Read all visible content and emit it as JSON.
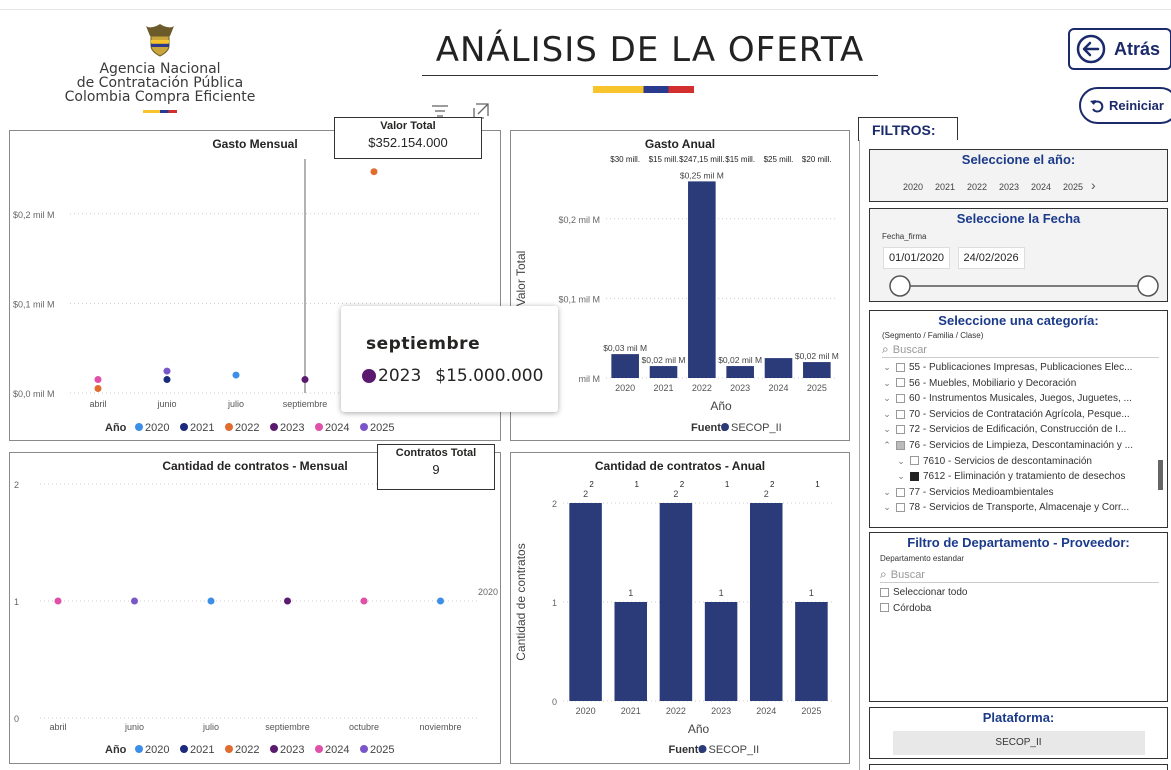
{
  "header": {
    "logo_line1": "Agencia Nacional",
    "logo_line2": "de Contratación Pública",
    "logo_line3": "Colombia Compra Eficiente",
    "title": "ANÁLISIS DE LA OFERTA",
    "back_label": "Atrás",
    "reset_label": "Reiniciar"
  },
  "colors": {
    "accent": "#1b2a6b",
    "bar": "#2b3a78",
    "year2020": "#3d8ee6",
    "year2021": "#1b2a7b",
    "year2022": "#e06c2f",
    "year2023": "#5b1a6f",
    "year2024": "#e04fa8",
    "year2025": "#7a56c8"
  },
  "cards": {
    "valor_total": {
      "label": "Valor Total",
      "value": "$352.154.000"
    },
    "contratos_total": {
      "label": "Contratos Total",
      "value": "9"
    }
  },
  "tooltip": {
    "month": "septiembre",
    "year": "2023",
    "value": "$15.000.000"
  },
  "chart_data": [
    {
      "id": "gasto_mensual",
      "type": "scatter",
      "title": "Gasto Mensual",
      "categories": [
        "abril",
        "junio",
        "julio",
        "septiembre"
      ],
      "y_ticks": [
        "$0,0 mil M",
        "$0,1 mil M",
        "$0,2 mil M"
      ],
      "ylim": [
        0,
        0.25
      ],
      "series": [
        {
          "name": "2020",
          "points": [
            {
              "x": "julio",
              "y": 0.02
            }
          ]
        },
        {
          "name": "2021",
          "points": [
            {
              "x": "junio",
              "y": 0.015
            }
          ]
        },
        {
          "name": "2022",
          "points": [
            {
              "x": "abril",
              "y": 0.005
            },
            {
              "x": "octubre",
              "y": 0.247
            }
          ]
        },
        {
          "name": "2023",
          "points": [
            {
              "x": "septiembre",
              "y": 0.015
            }
          ]
        },
        {
          "name": "2024",
          "points": [
            {
              "x": "abril",
              "y": 0.015
            }
          ]
        },
        {
          "name": "2025",
          "points": [
            {
              "x": "junio",
              "y": 0.02
            }
          ]
        }
      ],
      "legend_title": "Año",
      "legend": [
        "2020",
        "2021",
        "2022",
        "2023",
        "2024",
        "2025"
      ]
    },
    {
      "id": "gasto_anual",
      "type": "bar",
      "title": "Gasto Anual",
      "ylabel": "Valor Total",
      "xlabel": "Año",
      "categories": [
        "2020",
        "2021",
        "2022",
        "2023",
        "2024",
        "2025"
      ],
      "values": [
        0.03,
        0.015,
        0.247,
        0.015,
        0.025,
        0.02
      ],
      "data_labels": [
        "$0,03 mil M",
        "$0,02 mil M",
        "$0,25 mil M",
        "$0,02 mil M",
        "",
        "$0,02 mil M"
      ],
      "top_labels": [
        "$30 mill.",
        "$15 mill.",
        "$247,15 mill.",
        "$15 mill.",
        "$25 mill.",
        "$20 mill."
      ],
      "y_ticks": [
        "mil M",
        "$0,1 mil M",
        "$0,2 mil M"
      ],
      "ylim": [
        0,
        0.25
      ],
      "legend_title": "Fuente",
      "legend": [
        "SECOP_II"
      ]
    },
    {
      "id": "contratos_mensual",
      "type": "scatter",
      "title": "Cantidad de contratos - Mensual",
      "categories": [
        "abril",
        "junio",
        "julio",
        "septiembre",
        "octubre",
        "noviembre"
      ],
      "y_ticks": [
        "0",
        "1",
        "2"
      ],
      "ylim": [
        0,
        2
      ],
      "series": [
        {
          "name": "2020",
          "points": [
            {
              "x": "julio",
              "y": 1
            },
            {
              "x": "noviembre",
              "y": 1
            }
          ]
        },
        {
          "name": "2023",
          "points": [
            {
              "x": "septiembre",
              "y": 1
            }
          ]
        },
        {
          "name": "2024",
          "points": [
            {
              "x": "abril",
              "y": 1
            },
            {
              "x": "octubre",
              "y": 1
            }
          ]
        },
        {
          "name": "2025",
          "points": [
            {
              "x": "junio",
              "y": 1
            }
          ]
        }
      ],
      "right_label": "2020",
      "legend_title": "Año",
      "legend": [
        "2020",
        "2021",
        "2022",
        "2023",
        "2024",
        "2025"
      ]
    },
    {
      "id": "contratos_anual",
      "type": "bar",
      "title": "Cantidad de contratos - Anual",
      "ylabel": "Cantidad de contratos",
      "xlabel": "Año",
      "categories": [
        "2020",
        "2021",
        "2022",
        "2023",
        "2024",
        "2025"
      ],
      "values": [
        2,
        1,
        2,
        1,
        2,
        1
      ],
      "top_labels": [
        "2",
        "1",
        "2",
        "1",
        "2",
        "1"
      ],
      "y_ticks": [
        "0",
        "1",
        "2"
      ],
      "ylim": [
        0,
        2
      ],
      "legend_title": "Fuente",
      "legend": [
        "SECOP_II"
      ]
    }
  ],
  "filters": {
    "label": "FILTROS:",
    "year_slicer": {
      "title": "Seleccione el año:",
      "years": [
        "2020",
        "2021",
        "2022",
        "2023",
        "2024",
        "2025"
      ],
      "next_icon": "chevron-right-icon"
    },
    "date_slicer": {
      "title": "Seleccione la Fecha",
      "field": "Fecha_firma",
      "start": "01/01/2020",
      "end": "24/02/2026"
    },
    "category_slicer": {
      "title": "Seleccione una categoría:",
      "subtitle": "(Segmento / Familia / Clase)",
      "search_placeholder": "Buscar",
      "items": [
        "55 - Publicaciones Impresas, Publicaciones Elec...",
        "56 - Muebles, Mobiliario y Decoración",
        "60 - Instrumentos Musicales, Juegos, Juguetes, ...",
        "70 - Servicios de Contratación Agrícola, Pesque...",
        "72 - Servicios de Edificación, Construcción de I...",
        "76 - Servicios de Limpieza, Descontaminación y ...",
        "7610 - Servicios de descontaminación",
        "7612 - Eliminación y tratamiento de desechos",
        "77 - Servicios Medioambientales",
        "78 - Servicios de Transporte, Almacenaje y Corr..."
      ]
    },
    "department_slicer": {
      "title": "Filtro de Departamento - Proveedor:",
      "field": "Departamento estandar",
      "search_placeholder": "Buscar",
      "items": [
        "Seleccionar todo",
        "Córdoba"
      ]
    },
    "platform_slicer": {
      "title": "Plataforma:",
      "value": "SECOP_II"
    }
  }
}
